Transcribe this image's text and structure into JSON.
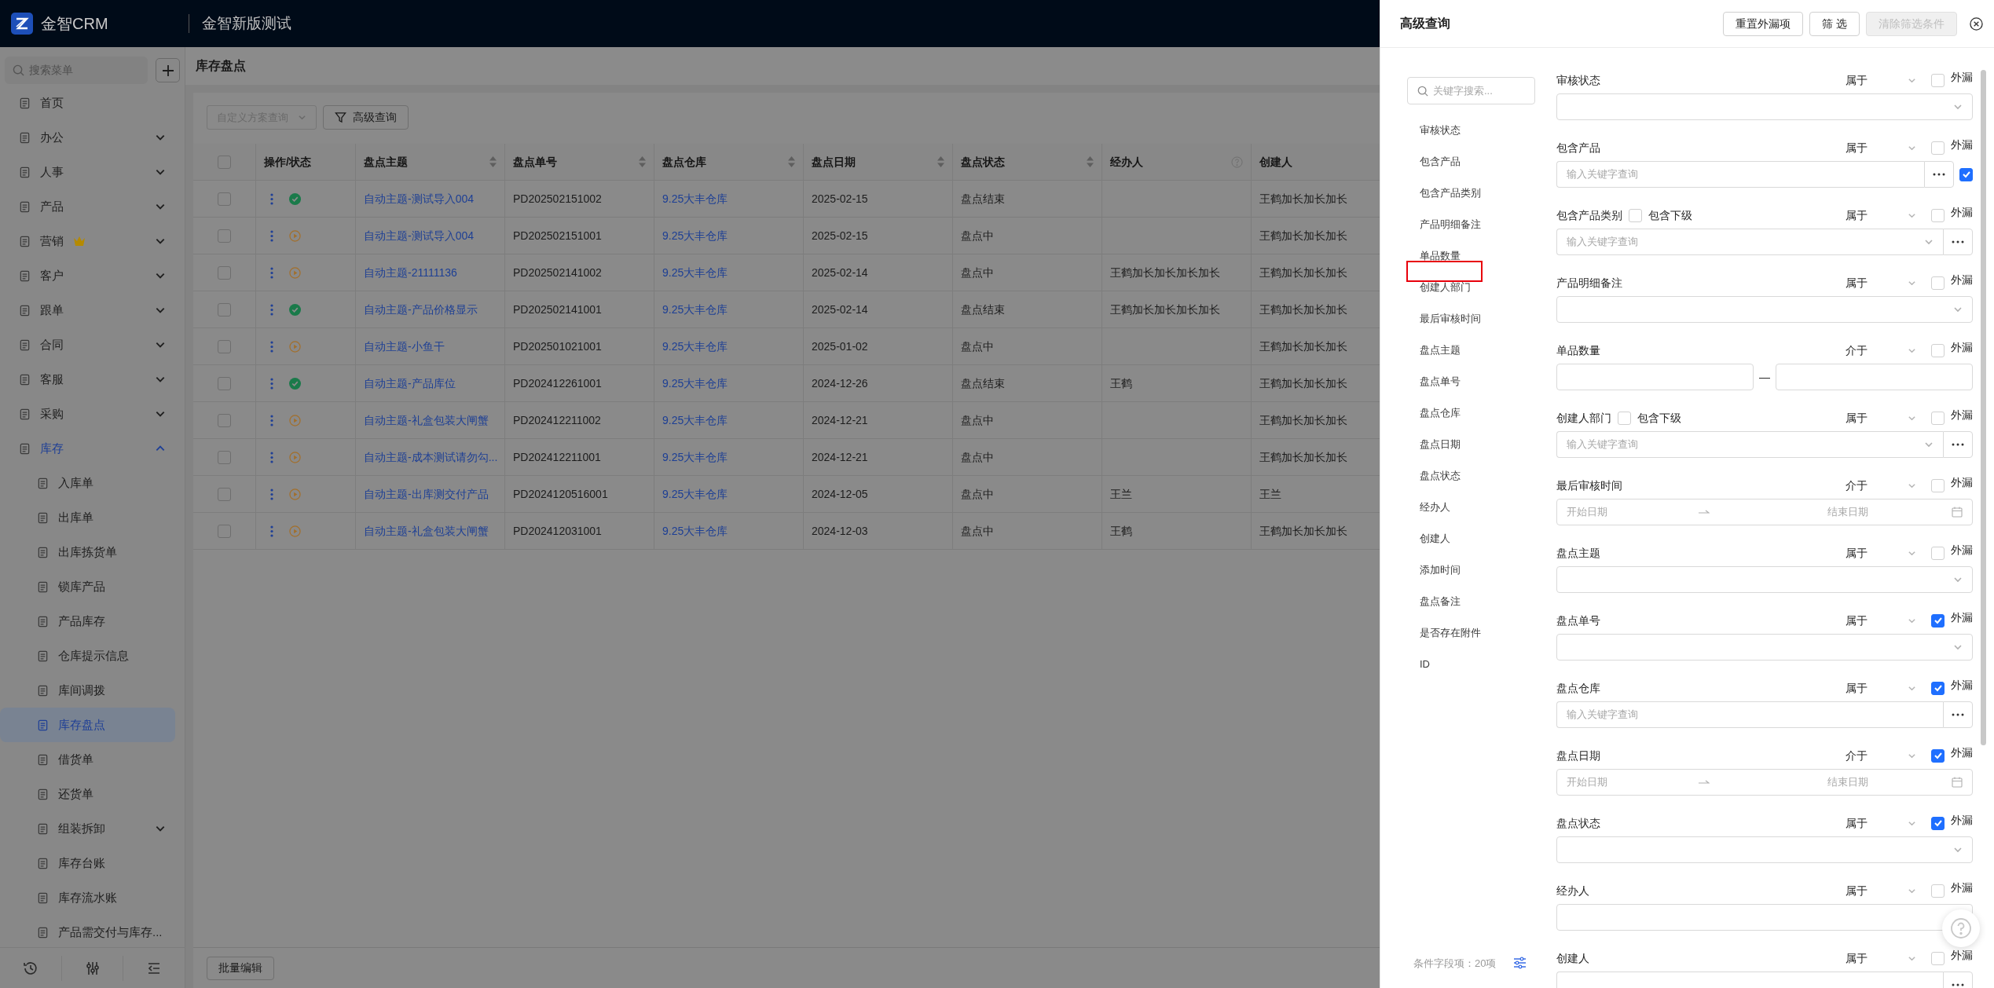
{
  "topbar": {
    "logo_text": "金智CRM",
    "workspace": "金智新版测试"
  },
  "sidebar": {
    "search_placeholder": "搜索菜单",
    "items": [
      {
        "label": "首页",
        "selected": false,
        "premium": false
      },
      {
        "label": "办公",
        "selected": false,
        "premium": false,
        "expanded": false
      },
      {
        "label": "人事",
        "selected": false,
        "premium": false,
        "expanded": false
      },
      {
        "label": "产品",
        "selected": false,
        "premium": false,
        "expanded": false
      },
      {
        "label": "营销",
        "selected": false,
        "premium": true,
        "expanded": false
      },
      {
        "label": "客户",
        "selected": false,
        "premium": false,
        "expanded": false
      },
      {
        "label": "跟单",
        "selected": false,
        "premium": false,
        "expanded": false
      },
      {
        "label": "合同",
        "selected": false,
        "premium": false,
        "expanded": false
      },
      {
        "label": "客服",
        "selected": false,
        "premium": false,
        "expanded": false
      },
      {
        "label": "采购",
        "selected": false,
        "premium": false,
        "expanded": false
      },
      {
        "label": "库存",
        "selected": false,
        "premium": false,
        "expanded": true,
        "children": [
          {
            "label": "入库单",
            "selected": false
          },
          {
            "label": "出库单",
            "selected": false
          },
          {
            "label": "出库拣货单",
            "selected": false
          },
          {
            "label": "锁库产品",
            "selected": false
          },
          {
            "label": "产品库存",
            "selected": false
          },
          {
            "label": "仓库提示信息",
            "selected": false
          },
          {
            "label": "库间调拨",
            "selected": false
          },
          {
            "label": "库存盘点",
            "selected": true
          },
          {
            "label": "借货单",
            "selected": false
          },
          {
            "label": "还货单",
            "selected": false
          },
          {
            "label": "组装拆卸",
            "selected": false,
            "expanded": false
          },
          {
            "label": "库存台账",
            "selected": false
          },
          {
            "label": "库存流水账",
            "selected": false
          },
          {
            "label": "产品需交付与库存...",
            "selected": false
          }
        ]
      }
    ]
  },
  "page": {
    "title": "库存盘点",
    "scheme_placeholder": "自定义方案查询",
    "advanced_button": "高级查询",
    "table": {
      "select_all": false,
      "columns": [
        {
          "label": "操作/状态",
          "sortable": false,
          "help": false
        },
        {
          "label": "盘点主题",
          "sortable": true,
          "help": false
        },
        {
          "label": "盘点单号",
          "sortable": true,
          "help": false
        },
        {
          "label": "盘点仓库",
          "sortable": true,
          "help": false
        },
        {
          "label": "盘点日期",
          "sortable": true,
          "help": false
        },
        {
          "label": "盘点状态",
          "sortable": true,
          "help": false
        },
        {
          "label": "经办人",
          "sortable": false,
          "help": true
        },
        {
          "label": "创建人",
          "sortable": false,
          "help": false
        }
      ],
      "rows": [
        {
          "checked": false,
          "finished": true,
          "subject": "自动主题-测试导入004",
          "number": "PD202502151002",
          "warehouse": "9.25大丰仓库",
          "date": "2025-02-15",
          "state": "盘点结束",
          "handler": "",
          "creator": "王鹤加长加长加长"
        },
        {
          "checked": false,
          "finished": false,
          "subject": "自动主题-测试导入004",
          "number": "PD202502151001",
          "warehouse": "9.25大丰仓库",
          "date": "2025-02-15",
          "state": "盘点中",
          "handler": "",
          "creator": "王鹤加长加长加长"
        },
        {
          "checked": false,
          "finished": false,
          "subject": "自动主题-21111136",
          "number": "PD202502141002",
          "warehouse": "9.25大丰仓库",
          "date": "2025-02-14",
          "state": "盘点中",
          "handler": "王鹤加长加长加长加长",
          "creator": "王鹤加长加长加长"
        },
        {
          "checked": false,
          "finished": true,
          "subject": "自动主题-产品价格显示",
          "number": "PD202502141001",
          "warehouse": "9.25大丰仓库",
          "date": "2025-02-14",
          "state": "盘点结束",
          "handler": "王鹤加长加长加长加长",
          "creator": "王鹤加长加长加长"
        },
        {
          "checked": false,
          "finished": false,
          "subject": "自动主题-小鱼干",
          "number": "PD202501021001",
          "warehouse": "9.25大丰仓库",
          "date": "2025-01-02",
          "state": "盘点中",
          "handler": "",
          "creator": "王鹤加长加长加长"
        },
        {
          "checked": false,
          "finished": true,
          "subject": "自动主题-产品库位",
          "number": "PD202412261001",
          "warehouse": "9.25大丰仓库",
          "date": "2024-12-26",
          "state": "盘点结束",
          "handler": "王鹤",
          "creator": "王鹤加长加长加长"
        },
        {
          "checked": false,
          "finished": false,
          "subject": "自动主题-礼盒包装大闸蟹",
          "number": "PD202412211002",
          "warehouse": "9.25大丰仓库",
          "date": "2024-12-21",
          "state": "盘点中",
          "handler": "",
          "creator": "王鹤加长加长加长"
        },
        {
          "checked": false,
          "finished": false,
          "subject": "自动主题-成本测试请勿勾...",
          "number": "PD202412211001",
          "warehouse": "9.25大丰仓库",
          "date": "2024-12-21",
          "state": "盘点中",
          "handler": "",
          "creator": "王鹤加长加长加长"
        },
        {
          "checked": false,
          "finished": false,
          "subject": "自动主题-出库测交付产品",
          "number": "PD2024120516001",
          "warehouse": "9.25大丰仓库",
          "date": "2024-12-05",
          "state": "盘点中",
          "handler": "王兰",
          "creator": "王兰"
        },
        {
          "checked": false,
          "finished": false,
          "subject": "自动主题-礼盒包装大闸蟹",
          "number": "PD202412031001",
          "warehouse": "9.25大丰仓库",
          "date": "2024-12-03",
          "state": "盘点中",
          "handler": "王鹤",
          "creator": "王鹤加长加长加长"
        }
      ]
    },
    "batch_button": "批量编辑"
  },
  "drawer": {
    "title": "高级查询",
    "buttons": [
      {
        "label": "重置外漏项",
        "disabled": false
      },
      {
        "label": "筛 选",
        "disabled": false
      },
      {
        "label": "清除筛选条件",
        "disabled": true
      }
    ],
    "field_list": {
      "search_placeholder": "关键字搜索...",
      "annotation_frame": true,
      "items": [
        "审核状态",
        "包含产品",
        "包含产品类别",
        "产品明细备注",
        "单品数量",
        "创建人部门",
        "最后审核时间",
        "盘点主题",
        "盘点单号",
        "盘点仓库",
        "盘点日期",
        "盘点状态",
        "经办人",
        "创建人",
        "添加时间",
        "盘点备注",
        "是否存在附件",
        "ID"
      ],
      "footer": "条件字段项：20项"
    },
    "filters": [
      {
        "label": "审核状态",
        "operator": "属于",
        "external_label": "外漏",
        "external": false,
        "kind": "select"
      },
      {
        "label": "包含产品",
        "operator": "属于",
        "external_label": "外漏",
        "external": false,
        "kind": "input_more",
        "placeholder": "输入关键字查询",
        "extra_checked": true
      },
      {
        "label": "包含产品类别",
        "include_sub": {
          "label": "包含下级",
          "checked": false
        },
        "operator": "属于",
        "external_label": "外漏",
        "external": false,
        "kind": "select_more",
        "placeholder": "输入关键字查询"
      },
      {
        "label": "产品明细备注",
        "operator": "属于",
        "external_label": "外漏",
        "external": false,
        "kind": "select"
      },
      {
        "label": "单品数量",
        "operator": "介于",
        "external_label": "外漏",
        "external": false,
        "kind": "range",
        "separator": "—"
      },
      {
        "label": "创建人部门",
        "include_sub": {
          "label": "包含下级",
          "checked": false
        },
        "operator": "属于",
        "external_label": "外漏",
        "external": false,
        "kind": "select_more",
        "placeholder": "输入关键字查询"
      },
      {
        "label": "最后审核时间",
        "operator": "介于",
        "external_label": "外漏",
        "external": false,
        "kind": "date_range",
        "start": "开始日期",
        "end": "结束日期"
      },
      {
        "label": "盘点主题",
        "operator": "属于",
        "external_label": "外漏",
        "external": false,
        "kind": "select"
      },
      {
        "label": "盘点单号",
        "operator": "属于",
        "external_label": "外漏",
        "external": true,
        "kind": "select"
      },
      {
        "label": "盘点仓库",
        "operator": "属于",
        "external_label": "外漏",
        "external": true,
        "kind": "input_more",
        "placeholder": "输入关键字查询"
      },
      {
        "label": "盘点日期",
        "operator": "介于",
        "external_label": "外漏",
        "external": true,
        "kind": "date_range",
        "start": "开始日期",
        "end": "结束日期"
      },
      {
        "label": "盘点状态",
        "operator": "属于",
        "external_label": "外漏",
        "external": true,
        "kind": "select"
      },
      {
        "label": "经办人",
        "operator": "属于",
        "external_label": "外漏",
        "external": false,
        "kind": "input"
      },
      {
        "label": "创建人",
        "operator": "属于",
        "external_label": "外漏",
        "external": false,
        "kind": "input_more"
      }
    ]
  }
}
